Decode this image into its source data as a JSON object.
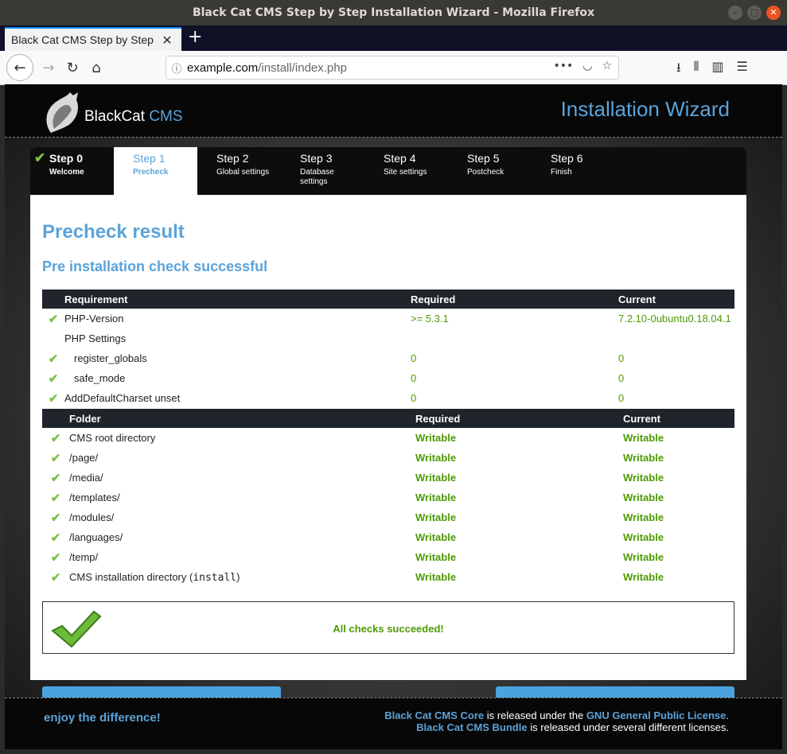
{
  "window": {
    "title": "Black Cat CMS Step by Step Installation Wizard - Mozilla Firefox"
  },
  "browser": {
    "tab_title": "Black Cat CMS Step by Step",
    "url_host": "example.com",
    "url_path": "/install/index.php"
  },
  "header": {
    "logo_name": "BlackCat",
    "logo_cms": "CMS",
    "title": "Installation Wizard"
  },
  "steps": [
    {
      "name": "Step 0",
      "desc": "Welcome",
      "state": "done"
    },
    {
      "name": "Step 1",
      "desc": "Precheck",
      "state": "active"
    },
    {
      "name": "Step 2",
      "desc": "Global settings",
      "state": ""
    },
    {
      "name": "Step 3",
      "desc": "Database settings",
      "state": ""
    },
    {
      "name": "Step 4",
      "desc": "Site settings",
      "state": ""
    },
    {
      "name": "Step 5",
      "desc": "Postcheck",
      "state": ""
    },
    {
      "name": "Step 6",
      "desc": "Finish",
      "state": ""
    }
  ],
  "content": {
    "heading": "Precheck result",
    "subheading": "Pre installation check successful",
    "req_table": {
      "headers": [
        "Requirement",
        "Required",
        "Current"
      ],
      "rows": [
        {
          "check": true,
          "name": "PHP-Version",
          "required": ">= 5.3.1",
          "current": "7.2.10-0ubuntu0.18.04.1"
        },
        {
          "check": false,
          "name": "PHP Settings",
          "required": "",
          "current": ""
        },
        {
          "check": true,
          "name": "register_globals",
          "required": "0",
          "current": "0",
          "indent": true
        },
        {
          "check": true,
          "name": "safe_mode",
          "required": "0",
          "current": "0",
          "indent": true
        },
        {
          "check": true,
          "name": "AddDefaultCharset unset",
          "required": "0",
          "current": "0"
        }
      ]
    },
    "folder_table": {
      "headers": [
        "Folder",
        "Required",
        "Current"
      ],
      "rows": [
        {
          "name": "CMS root directory",
          "required": "Writable",
          "current": "Writable"
        },
        {
          "name": "/page/",
          "required": "Writable",
          "current": "Writable"
        },
        {
          "name": "/media/",
          "required": "Writable",
          "current": "Writable"
        },
        {
          "name": "/templates/",
          "required": "Writable",
          "current": "Writable"
        },
        {
          "name": "/modules/",
          "required": "Writable",
          "current": "Writable"
        },
        {
          "name": "/languages/",
          "required": "Writable",
          "current": "Writable"
        },
        {
          "name": "/temp/",
          "required": "Writable",
          "current": "Writable"
        }
      ],
      "install_row": {
        "prefix": "CMS installation directory (",
        "code": "install",
        "suffix": ")",
        "required": "Writable",
        "current": "Writable"
      }
    },
    "result": "All checks succeeded!"
  },
  "footer": {
    "tagline": "enjoy the difference!",
    "core_link": "Black Cat CMS Core",
    "core_text": " is released under the ",
    "gpl_link": "GNU General Public License",
    "gpl_end": ".",
    "bundle_link": "Black Cat CMS Bundle",
    "bundle_text": " is released under several different licenses."
  },
  "colors": {
    "accent": "#5ba3d9",
    "ok": "#4e9a06",
    "check": "#7bc24a"
  }
}
